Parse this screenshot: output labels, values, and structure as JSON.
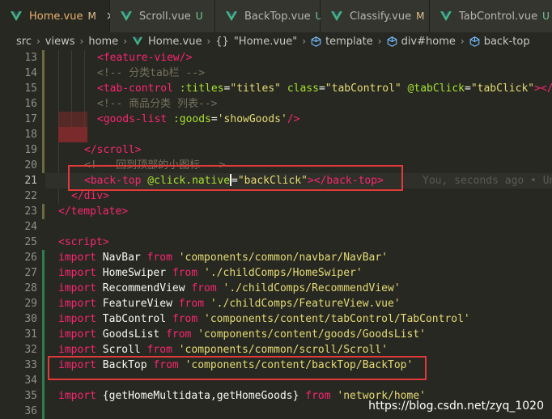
{
  "tabs": [
    {
      "label": "Home.vue",
      "status": "M",
      "active": true,
      "close": "×"
    },
    {
      "label": "Scroll.vue",
      "status": "U",
      "active": false
    },
    {
      "label": "BackTop.vue",
      "status": "U",
      "active": false
    },
    {
      "label": "Classify.vue",
      "status": "M",
      "active": false
    },
    {
      "label": "TabControl.vue",
      "status": "U",
      "active": false
    }
  ],
  "breadcrumb": {
    "items": [
      "src",
      "views",
      "home"
    ],
    "file": "Home.vue",
    "symbol": "\"Home.vue\"",
    "template": "template",
    "div": "div#home",
    "backtop": "back-top"
  },
  "lines": [
    {
      "n": "13",
      "parts": [
        [
          "tg",
          "<feature-view/>"
        ]
      ]
    },
    {
      "n": "14",
      "parts": [
        [
          "cm",
          "<!-- 分类tab栏 -->"
        ]
      ]
    },
    {
      "n": "15",
      "parts": [
        [
          "tg",
          "<tab-control "
        ],
        [
          "at",
          ":titles"
        ],
        [
          "pl",
          "="
        ],
        [
          "st",
          "\"titles\""
        ],
        [
          "pl",
          " "
        ],
        [
          "at",
          "class"
        ],
        [
          "pl",
          "="
        ],
        [
          "st",
          "\"tabControl\""
        ],
        [
          "pl",
          " "
        ],
        [
          "at",
          "@tabClick"
        ],
        [
          "pl",
          "="
        ],
        [
          "st",
          "\"tabClick\""
        ],
        [
          "tg",
          "></ta"
        ]
      ]
    },
    {
      "n": "16",
      "parts": [
        [
          "cm",
          "<!-- 商品分类 列表-->"
        ]
      ]
    },
    {
      "n": "17",
      "parts": [
        [
          "tg",
          "<goods-list "
        ],
        [
          "at",
          ":goods"
        ],
        [
          "pl",
          "="
        ],
        [
          "st",
          "'showGoods'"
        ],
        [
          "tg",
          "/>"
        ]
      ]
    },
    {
      "n": "18",
      "parts": []
    },
    {
      "n": "19",
      "parts": [
        [
          "tg",
          "</scroll>"
        ]
      ]
    },
    {
      "n": "20",
      "parts": [
        [
          "cm",
          "<!-- 回到顶部的小图标 -->"
        ]
      ]
    },
    {
      "n": "21",
      "parts": [
        [
          "tg",
          "<back-top "
        ],
        [
          "at",
          "@click.native"
        ],
        [
          "pl",
          "="
        ],
        [
          "st",
          "\"backClick\""
        ],
        [
          "tg",
          "></back-top>"
        ]
      ]
    },
    {
      "n": "22",
      "parts": [
        [
          "tg",
          "</div>"
        ]
      ]
    },
    {
      "n": "23",
      "parts": [
        [
          "tg",
          "</template>"
        ]
      ]
    },
    {
      "n": "24",
      "parts": []
    },
    {
      "n": "25",
      "parts": [
        [
          "tg",
          "<script>"
        ]
      ]
    },
    {
      "n": "26",
      "parts": [
        [
          "kw",
          "import "
        ],
        [
          "id",
          "NavBar "
        ],
        [
          "kw",
          "from "
        ],
        [
          "st",
          "'components/common/navbar/NavBar'"
        ]
      ]
    },
    {
      "n": "27",
      "parts": [
        [
          "kw",
          "import "
        ],
        [
          "id",
          "HomeSwiper "
        ],
        [
          "kw",
          "from "
        ],
        [
          "st",
          "'./childComps/HomeSwiper'"
        ]
      ]
    },
    {
      "n": "28",
      "parts": [
        [
          "kw",
          "import "
        ],
        [
          "id",
          "RecommendView "
        ],
        [
          "kw",
          "from "
        ],
        [
          "st",
          "'./childComps/RecommendView'"
        ]
      ]
    },
    {
      "n": "29",
      "parts": [
        [
          "kw",
          "import "
        ],
        [
          "id",
          "FeatureView "
        ],
        [
          "kw",
          "from "
        ],
        [
          "st",
          "'./childComps/FeatureView.vue'"
        ]
      ]
    },
    {
      "n": "30",
      "parts": [
        [
          "kw",
          "import "
        ],
        [
          "id",
          "TabControl "
        ],
        [
          "kw",
          "from "
        ],
        [
          "st",
          "'components/content/tabControl/TabControl'"
        ]
      ]
    },
    {
      "n": "31",
      "parts": [
        [
          "kw",
          "import "
        ],
        [
          "id",
          "GoodsList "
        ],
        [
          "kw",
          "from "
        ],
        [
          "st",
          "'components/content/goods/GoodsList'"
        ]
      ]
    },
    {
      "n": "32",
      "parts": [
        [
          "kw",
          "import "
        ],
        [
          "id",
          "Scroll "
        ],
        [
          "kw",
          "from "
        ],
        [
          "st",
          "'components/common/scroll/Scroll'"
        ]
      ]
    },
    {
      "n": "33",
      "parts": [
        [
          "kw",
          "import "
        ],
        [
          "id",
          "BackTop "
        ],
        [
          "kw",
          "from "
        ],
        [
          "st",
          "'components/content/backTop/BackTop'"
        ]
      ]
    },
    {
      "n": "34",
      "parts": []
    },
    {
      "n": "35",
      "parts": [
        [
          "kw",
          "import "
        ],
        [
          "pl",
          "{"
        ],
        [
          "id",
          "getHomeMultidata"
        ],
        [
          "pl",
          ","
        ],
        [
          "id",
          "getHomeGoods"
        ],
        [
          "pl",
          "} "
        ],
        [
          "kw",
          "from "
        ],
        [
          "st",
          "'network/home'"
        ]
      ]
    },
    {
      "n": "36",
      "parts": []
    }
  ],
  "blame": "You, seconds ago • Un",
  "watermark": "https://blog.csdn.net/zyq_1020"
}
